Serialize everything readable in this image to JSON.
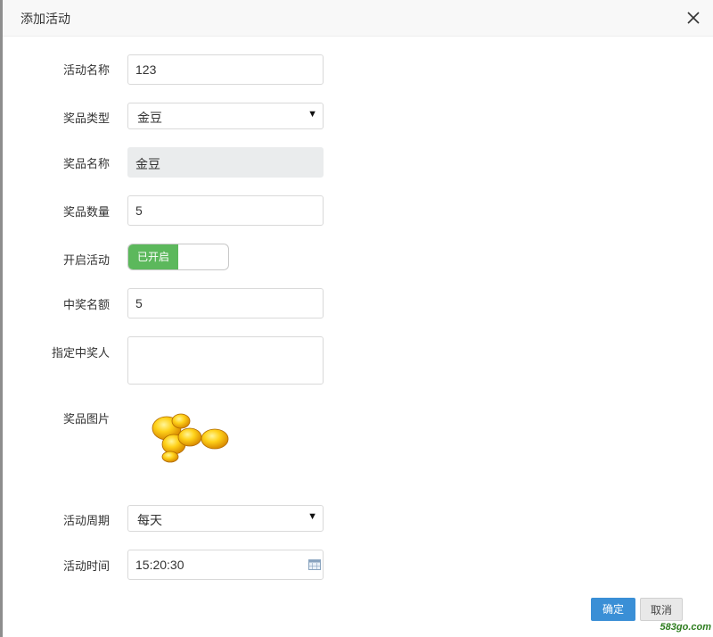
{
  "dialog": {
    "title": "添加活动"
  },
  "form": {
    "activity_name": {
      "label": "活动名称",
      "value": "123"
    },
    "prize_type": {
      "label": "奖品类型",
      "value": "金豆"
    },
    "prize_name": {
      "label": "奖品名称",
      "value": "金豆"
    },
    "prize_count": {
      "label": "奖品数量",
      "value": "5"
    },
    "activity_enabled": {
      "label": "开启活动",
      "on_text": "已开启",
      "enabled": true
    },
    "winner_count": {
      "label": "中奖名额",
      "value": "5"
    },
    "designated_winner": {
      "label": "指定中奖人",
      "value": ""
    },
    "prize_image": {
      "label": "奖品图片",
      "icon": "gold-beans-image"
    },
    "activity_cycle": {
      "label": "活动周期",
      "value": "每天"
    },
    "activity_time": {
      "label": "活动时间",
      "value": "15:20:30",
      "icon": "calendar-icon"
    }
  },
  "buttons": {
    "confirm": "确定",
    "cancel": "取消"
  },
  "watermark": {
    "url": "583go.com"
  },
  "colors": {
    "toggle_on": "#5cb85c",
    "confirm_button": "#3a8fd6",
    "readonly_field": "#eaeced",
    "header_bg": "#f8f8f8"
  }
}
